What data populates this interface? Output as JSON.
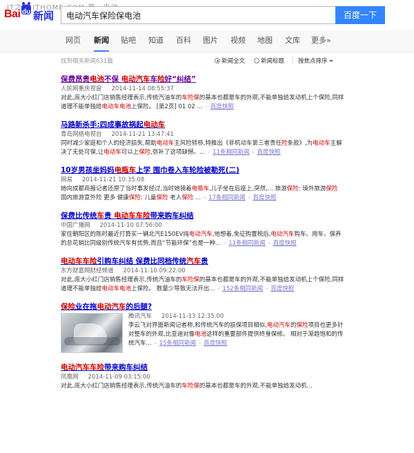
{
  "watermark": "IT之家 ITHOME.COM  第一电动",
  "header": {
    "logo": {
      "bai": "Bai",
      "du": "du",
      "news": "新闻"
    },
    "search_value": "电动汽车保险保电池",
    "search_button": "百度一下"
  },
  "tabs": [
    {
      "label": "网页",
      "active": false
    },
    {
      "label": "新闻",
      "active": true
    },
    {
      "label": "贴吧",
      "active": false
    },
    {
      "label": "知道",
      "active": false
    },
    {
      "label": "百科",
      "active": false
    },
    {
      "label": "图片",
      "active": false
    },
    {
      "label": "视频",
      "active": false
    },
    {
      "label": "地图",
      "active": false
    },
    {
      "label": "文库",
      "active": false
    },
    {
      "label": "更多»",
      "active": false
    }
  ],
  "stats": {
    "count_text": "找到相关新闻631篇",
    "option_full": "新闻全文",
    "option_title": "新闻标题",
    "sort_label": "按焦点排序",
    "selected": "新闻全文"
  },
  "results": [
    {
      "title": [
        {
          "t": "保费昂贵"
        },
        {
          "t": "电池",
          "em": true
        },
        {
          "t": "不保 "
        },
        {
          "t": "电动汽车",
          "em": true
        },
        {
          "t": "车"
        },
        {
          "t": "险",
          "em": true
        },
        {
          "t": "好“纠结”"
        }
      ],
      "visited": true,
      "source": "人民网重庆视窗",
      "time": "2014-11-14 08:55:37",
      "abstract": [
        {
          "t": "对此,庞大小红门店销售经理表示,传统汽油车的"
        },
        {
          "t": "车险保",
          "em": true
        },
        {
          "t": "的基本也都是车的外观,不能单独给发动机上个保险,同样道理不能单独给"
        },
        {
          "t": "电动车电池",
          "em": true
        },
        {
          "t": "上保险。 [第2页] 01 02 ..."
        }
      ],
      "links": [
        {
          "label": "百度快照",
          "gray": false
        }
      ]
    },
    {
      "title": [
        {
          "t": "马路新杀手:四成事故祸起"
        },
        {
          "t": "电动车",
          "em": true
        }
      ],
      "visited": false,
      "source": "青岛网络电视台",
      "time": "2014-11-21 13:47:41",
      "abstract": [
        {
          "t": "同时减少家庭和个人的经济损失,帮助"
        },
        {
          "t": "电动车",
          "em": true
        },
        {
          "t": "主风险转移,特推出《非机动车第三者责任"
        },
        {
          "t": "险",
          "em": true
        },
        {
          "t": "条款》,为"
        },
        {
          "t": "电动车",
          "em": true
        },
        {
          "t": "主解决了无处可保,让"
        },
        {
          "t": "电动车",
          "em": true
        },
        {
          "t": "可以上"
        },
        {
          "t": "保险",
          "em": true
        },
        {
          "t": ",弥补了这项缺憾。..."
        }
      ],
      "links": [
        {
          "label": "11条相同新闻",
          "gray": false
        },
        {
          "label": "百度快照",
          "gray": false
        }
      ]
    },
    {
      "title": [
        {
          "t": "10岁男孩坐妈妈"
        },
        {
          "t": "电瓶车",
          "em": true
        },
        {
          "t": "上学 围巾卷入车轮险被勒死(二)"
        }
      ],
      "visited": false,
      "source": "网易",
      "time": "2014-11-21 10:35:08",
      "abstract": [
        {
          "t": "她向成都商报记者还原了当时事发经过,当时她骑着"
        },
        {
          "t": "电瓶车",
          "em": true
        },
        {
          "t": ",儿子坐在后座上,突然,... 旅游"
        },
        {
          "t": "保险",
          "em": true
        },
        {
          "t": ": 境外旅游"
        },
        {
          "t": "保险",
          "em": true
        },
        {
          "t": " 国内旅游意外险 更多 健康"
        },
        {
          "t": "保险",
          "em": true
        },
        {
          "t": ": 儿童"
        },
        {
          "t": "保险",
          "em": true
        },
        {
          "t": " 老人"
        },
        {
          "t": "保险",
          "em": true
        },
        {
          "t": " ..."
        }
      ],
      "links": [
        {
          "label": "17条相同新闻",
          "gray": false
        },
        {
          "label": "百度快照",
          "gray": false
        }
      ]
    },
    {
      "title": [
        {
          "t": "保费比传统"
        },
        {
          "t": "车",
          "em": true
        },
        {
          "t": "贵 "
        },
        {
          "t": "电动车车险",
          "em": true
        },
        {
          "t": "带来购车纠结"
        }
      ],
      "visited": false,
      "source": "中国广播网",
      "time": "2014-11-10 07:56:00",
      "abstract": [
        {
          "t": "家住朝阳区的陈时最近打算买一辆北汽E150EV纯"
        },
        {
          "t": "电动汽车",
          "em": true
        },
        {
          "t": ",他想着,免征购置税后,"
        },
        {
          "t": "电动汽车",
          "em": true
        },
        {
          "t": "购车、用车、保养的总花销比同级别传统汽车有优势,而且“节能环保”也是一种..."
        }
      ],
      "links": [
        {
          "label": "11条相同新闻",
          "gray": false
        },
        {
          "label": "百度快照",
          "gray": false
        }
      ]
    },
    {
      "title": [
        {
          "t": "电动车车险",
          "em": true
        },
        {
          "t": "引购车纠结 保费比同档传统"
        },
        {
          "t": "汽车",
          "em": true
        },
        {
          "t": "贵"
        }
      ],
      "visited": false,
      "source": "东方财富网财经频道",
      "time": "2014-11-10 09:22:00",
      "abstract": [
        {
          "t": "对此,庞大小红门店销售经理表示,传统汽油车的"
        },
        {
          "t": "车险保",
          "em": true
        },
        {
          "t": "的基本也都是车的外观,不能单独给发动机上个保险,同样道理不能单独给"
        },
        {
          "t": "电动车电池",
          "em": true
        },
        {
          "t": "上保险。 数量少导致无法开出..."
        }
      ],
      "links": [
        {
          "label": "152条相同新闻",
          "gray": false
        },
        {
          "label": "百度快照",
          "gray": false
        }
      ]
    },
    {
      "title": [
        {
          "t": "保险",
          "em": true
        },
        {
          "t": "业在拖"
        },
        {
          "t": "电动汽车",
          "em": true
        },
        {
          "t": "的后腿?"
        }
      ],
      "visited": false,
      "thumb": true,
      "source": "腾讯汽车",
      "time": "2014-11-13 12:35:00",
      "abstract": [
        {
          "t": "李云飞对界面新闻记者称,和传统汽车的损保项目相似,"
        },
        {
          "t": "电动汽车",
          "em": true
        },
        {
          "t": "的"
        },
        {
          "t": "保险",
          "em": true
        },
        {
          "t": "项目也更多针对整车的外观,比亚迪对像"
        },
        {
          "t": "电池",
          "em": true
        },
        {
          "t": "这样的重要部件提供终身保修。 相对于渐趋饱和的传统汽车..."
        }
      ],
      "links": [
        {
          "label": "15条相同新闻",
          "gray": false
        },
        {
          "label": "百度快照",
          "gray": false
        }
      ]
    },
    {
      "title": [
        {
          "t": "电动汽车车险",
          "em": true
        },
        {
          "t": "带来购车纠结"
        }
      ],
      "visited": false,
      "source": "凤凰网",
      "time": "2014-11-09 03:15:00",
      "abstract": [
        {
          "t": "对此,庞大小红门店销售经理表示,传统汽油车的"
        },
        {
          "t": "车险保",
          "em": true
        },
        {
          "t": "的基本也都是车的外观,不能单独给发动机..."
        }
      ],
      "links": []
    }
  ]
}
